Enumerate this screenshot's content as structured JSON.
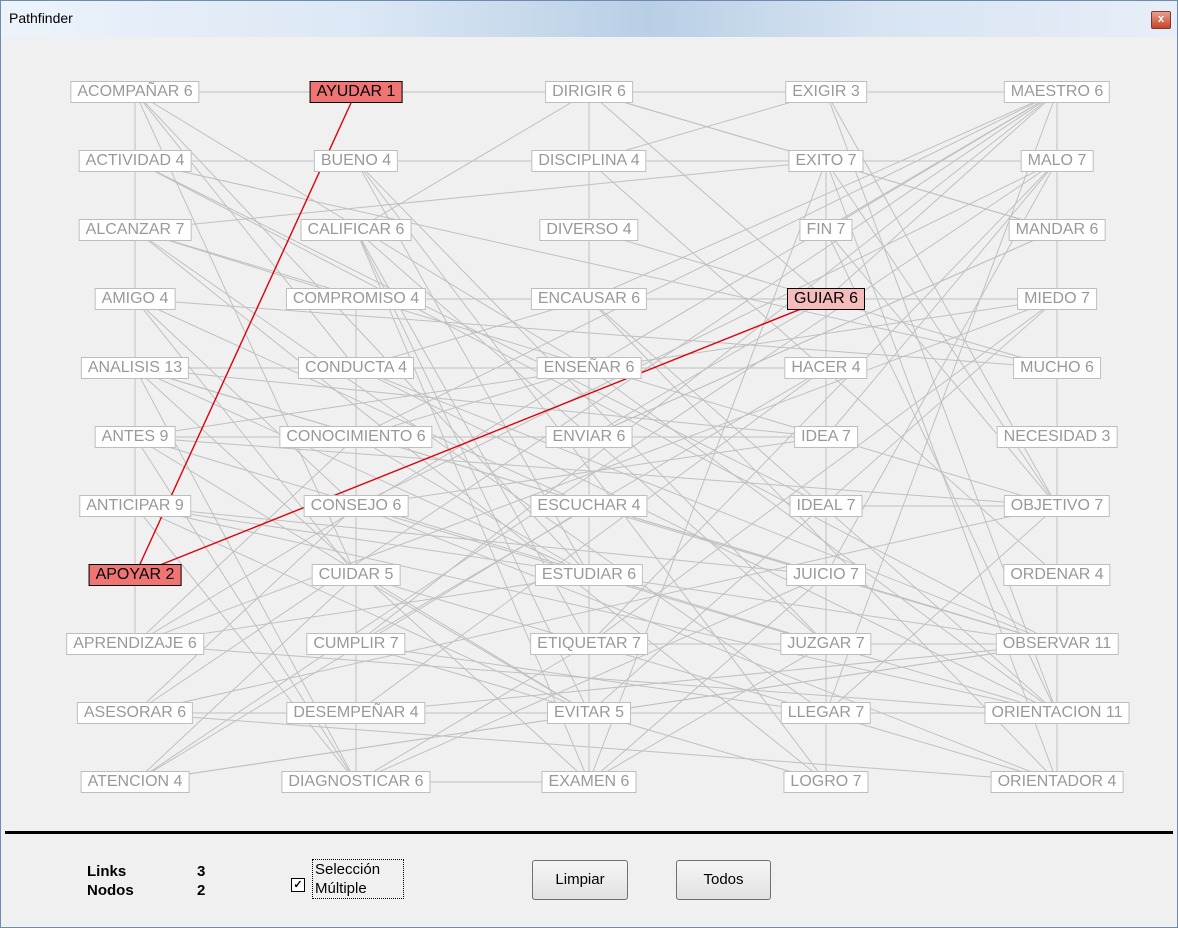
{
  "window": {
    "title": "Pathfinder",
    "close_glyph": "x"
  },
  "columns": [
    {
      "x": 0,
      "nodes": [
        "ACOMPAÑAR 6",
        "ACTIVIDAD 4",
        "ALCANZAR 7",
        "AMIGO 4",
        "ANALISIS 13",
        "ANTES 9",
        "ANTICIPAR 9",
        "APOYAR 2",
        "APRENDIZAJE 6",
        "ASESORAR 6",
        "ATENCION 4"
      ]
    },
    {
      "x": 1,
      "nodes": [
        "AYUDAR 1",
        "BUENO 4",
        "CALIFICAR 6",
        "COMPROMISO 4",
        "CONDUCTA 4",
        "CONOCIMIENTO 6",
        "CONSEJO 6",
        "CUIDAR 5",
        "CUMPLIR 7",
        "DESEMPEÑAR 4",
        "DIAGNOSTICAR 6"
      ]
    },
    {
      "x": 2,
      "nodes": [
        "DIRIGIR 6",
        "DISCIPLINA 4",
        "DIVERSO 4",
        "ENCAUSAR 6",
        "ENSEÑAR 6",
        "ENVIAR 6",
        "ESCUCHAR 4",
        "ESTUDIAR 6",
        "ETIQUETAR 7",
        "EVITAR 5",
        "EXAMEN 6"
      ]
    },
    {
      "x": 3,
      "nodes": [
        "EXIGIR 3",
        "EXITO 7",
        "FIN 7",
        "GUIAR 6",
        "HACER 4",
        "IDEA 7",
        "IDEAL 7",
        "JUICIO 7",
        "JUZGAR 7",
        "LLEGAR 7",
        "LOGRO 7"
      ]
    },
    {
      "x": 4,
      "nodes": [
        "MAESTRO 6",
        "MALO 7",
        "MANDAR 6",
        "MIEDO 7",
        "MUCHO 6",
        "NECESIDAD 3",
        "OBJETIVO 7",
        "ORDENAR 4",
        "OBSERVAR 11",
        "ORIENTACION 11",
        "ORIENTADOR 4"
      ]
    }
  ],
  "selected_nodes": [
    "AYUDAR 1",
    "APOYAR 2"
  ],
  "half_selected_nodes": [
    "GUIAR 6"
  ],
  "highlight_path": [
    [
      "AYUDAR 1",
      "APOYAR 2"
    ],
    [
      "APOYAR 2",
      "GUIAR 6"
    ]
  ],
  "edges": [
    [
      "ACOMPAÑAR 6",
      "AYUDAR 1"
    ],
    [
      "AYUDAR 1",
      "DIRIGIR 6"
    ],
    [
      "DIRIGIR 6",
      "EXIGIR 3"
    ],
    [
      "EXIGIR 3",
      "MAESTRO 6"
    ],
    [
      "ACOMPAÑAR 6",
      "APRENDIZAJE 6"
    ],
    [
      "ACOMPAÑAR 6",
      "CONDUCTA 4"
    ],
    [
      "ACOMPAÑAR 6",
      "ESTUDIAR 6"
    ],
    [
      "ACOMPAÑAR 6",
      "CUIDAR 5"
    ],
    [
      "ACOMPAÑAR 6",
      "ENSEÑAR 6"
    ],
    [
      "MAESTRO 6",
      "ORIENTACION 11"
    ],
    [
      "MAESTRO 6",
      "GUIAR 6"
    ],
    [
      "MAESTRO 6",
      "FIN 7"
    ],
    [
      "MAESTRO 6",
      "ENCAUSAR 6"
    ],
    [
      "MAESTRO 6",
      "CUMPLIR 7"
    ],
    [
      "DIRIGIR 6",
      "ENSEÑAR 6"
    ],
    [
      "DIRIGIR 6",
      "GUIAR 6"
    ],
    [
      "DIRIGIR 6",
      "CALIFICAR 6"
    ],
    [
      "DIRIGIR 6",
      "MANDAR 6"
    ],
    [
      "DIRIGIR 6",
      "ENCAUSAR 6"
    ],
    [
      "EXIGIR 3",
      "OBJETIVO 7"
    ],
    [
      "EXIGIR 3",
      "ORIENTACION 11"
    ],
    [
      "ACTIVIDAD 4",
      "EXITO 7"
    ],
    [
      "ACTIVIDAD 4",
      "IDEAL 7"
    ],
    [
      "ACTIVIDAD 4",
      "OBSERVAR 11"
    ],
    [
      "BUENO 4",
      "MALO 7"
    ],
    [
      "BUENO 4",
      "ESTUDIAR 6"
    ],
    [
      "BUENO 4",
      "JUZGAR 7"
    ],
    [
      "BUENO 4",
      "LOGRO 7"
    ],
    [
      "DISCIPLINA 4",
      "ORDENAR 4"
    ],
    [
      "DISCIPLINA 4",
      "EXAMEN 6"
    ],
    [
      "DISCIPLINA 4",
      "EXIGIR 3"
    ],
    [
      "DISCIPLINA 4",
      "ENVIAR 6"
    ],
    [
      "EXITO 7",
      "FIN 7"
    ],
    [
      "EXITO 7",
      "OBJETIVO 7"
    ],
    [
      "EXITO 7",
      "LOGRO 7"
    ],
    [
      "EXITO 7",
      "ORIENTADOR 4"
    ],
    [
      "EXITO 7",
      "ALCANZAR 7"
    ],
    [
      "MALO 7",
      "ATENCION 4"
    ],
    [
      "MALO 7",
      "IDEA 7"
    ],
    [
      "MALO 7",
      "JUICIO 7"
    ],
    [
      "MALO 7",
      "CONSEJO 6"
    ],
    [
      "MALO 7",
      "ETIQUETAR 7"
    ],
    [
      "ALCANZAR 7",
      "LOGRO 7"
    ],
    [
      "ALCANZAR 7",
      "OBJETIVO 7"
    ],
    [
      "ALCANZAR 7",
      "LLEGAR 7"
    ],
    [
      "ALCANZAR 7",
      "COMPROMISO 4"
    ],
    [
      "CALIFICAR 6",
      "EXAMEN 6"
    ],
    [
      "CALIFICAR 6",
      "JUZGAR 7"
    ],
    [
      "CALIFICAR 6",
      "ETIQUETAR 7"
    ],
    [
      "CALIFICAR 6",
      "EVITAR 5"
    ],
    [
      "DIVERSO 4",
      "MUCHO 6"
    ],
    [
      "DIVERSO 4",
      "ESTUDIAR 6"
    ],
    [
      "FIN 7",
      "OBJETIVO 7"
    ],
    [
      "FIN 7",
      "IDEAL 7"
    ],
    [
      "FIN 7",
      "LLEGAR 7"
    ],
    [
      "FIN 7",
      "ORIENTACION 11"
    ],
    [
      "MANDAR 6",
      "ORDENAR 4"
    ],
    [
      "MANDAR 6",
      "ENVIAR 6"
    ],
    [
      "MANDAR 6",
      "DIRIGIR 6"
    ],
    [
      "AMIGO 4",
      "CONSEJO 6"
    ],
    [
      "AMIGO 4",
      "ESCUCHAR 4"
    ],
    [
      "AMIGO 4",
      "CUIDAR 5"
    ],
    [
      "AMIGO 4",
      "ACOMPAÑAR 6"
    ],
    [
      "COMPROMISO 4",
      "CUMPLIR 7"
    ],
    [
      "COMPROMISO 4",
      "DESEMPEÑAR 4"
    ],
    [
      "COMPROMISO 4",
      "MIEDO 7"
    ],
    [
      "ENCAUSAR 6",
      "ORIENTACION 11"
    ],
    [
      "ENCAUSAR 6",
      "DIRIGIR 6"
    ],
    [
      "ENCAUSAR 6",
      "GUIAR 6"
    ],
    [
      "ENCAUSAR 6",
      "CONDUCTA 4"
    ],
    [
      "ENCAUSAR 6",
      "ORIENTADOR 4"
    ],
    [
      "MIEDO 7",
      "EVITAR 5"
    ],
    [
      "MIEDO 7",
      "NECESIDAD 3"
    ],
    [
      "MIEDO 7",
      "ANTES 9"
    ],
    [
      "ANALISIS 13",
      "OBSERVAR 11"
    ],
    [
      "ANALISIS 13",
      "ESTUDIAR 6"
    ],
    [
      "ANALISIS 13",
      "JUICIO 7"
    ],
    [
      "ANALISIS 13",
      "DIAGNOSTICAR 6"
    ],
    [
      "ANALISIS 13",
      "IDEA 7"
    ],
    [
      "ANALISIS 13",
      "EXAMEN 6"
    ],
    [
      "ANALISIS 13",
      "HACER 4"
    ],
    [
      "CONDUCTA 4",
      "ORIENTACION 11"
    ],
    [
      "CONDUCTA 4",
      "OBSERVAR 11"
    ],
    [
      "ENSEÑAR 6",
      "MAESTRO 6"
    ],
    [
      "ENSEÑAR 6",
      "APRENDIZAJE 6"
    ],
    [
      "ENSEÑAR 6",
      "ORIENTACION 11"
    ],
    [
      "ENSEÑAR 6",
      "CONOCIMIENTO 6"
    ],
    [
      "HACER 4",
      "CUMPLIR 7"
    ],
    [
      "HACER 4",
      "DESEMPEÑAR 4"
    ],
    [
      "MUCHO 6",
      "ACTIVIDAD 4"
    ],
    [
      "MUCHO 6",
      "AMIGO 4"
    ],
    [
      "ANTES 9",
      "ANTICIPAR 9"
    ],
    [
      "ANTES 9",
      "JUZGAR 7"
    ],
    [
      "ANTES 9",
      "EVITAR 5"
    ],
    [
      "ANTES 9",
      "ENVIAR 6"
    ],
    [
      "ANTES 9",
      "DIAGNOSTICAR 6"
    ],
    [
      "ANTES 9",
      "OBJETIVO 7"
    ],
    [
      "CONOCIMIENTO 6",
      "APRENDIZAJE 6"
    ],
    [
      "CONOCIMIENTO 6",
      "ESTUDIAR 6"
    ],
    [
      "CONOCIMIENTO 6",
      "IDEA 7"
    ],
    [
      "CONOCIMIENTO 6",
      "MAESTRO 6"
    ],
    [
      "ENVIAR 6",
      "MANDAR 6"
    ],
    [
      "ENVIAR 6",
      "GUIAR 6"
    ],
    [
      "IDEA 7",
      "IDEAL 7"
    ],
    [
      "IDEA 7",
      "JUICIO 7"
    ],
    [
      "IDEA 7",
      "CONSEJO 6"
    ],
    [
      "NECESIDAD 3",
      "ORIENTADOR 4"
    ],
    [
      "ANTICIPAR 9",
      "OBSERVAR 11"
    ],
    [
      "ANTICIPAR 9",
      "JUICIO 7"
    ],
    [
      "ANTICIPAR 9",
      "ORIENTACION 11"
    ],
    [
      "ANTICIPAR 9",
      "DIAGNOSTICAR 6"
    ],
    [
      "ANTICIPAR 9",
      "EVITAR 5"
    ],
    [
      "CONSEJO 6",
      "ORIENTACION 11"
    ],
    [
      "CONSEJO 6",
      "ASESORAR 6"
    ],
    [
      "CONSEJO 6",
      "ORIENTADOR 4"
    ],
    [
      "ESCUCHAR 4",
      "OBSERVAR 11"
    ],
    [
      "ESCUCHAR 4",
      "ATENCION 4"
    ],
    [
      "IDEAL 7",
      "OBJETIVO 7"
    ],
    [
      "IDEAL 7",
      "LOGRO 7"
    ],
    [
      "OBJETIVO 7",
      "LLEGAR 7"
    ],
    [
      "OBJETIVO 7",
      "ASESORAR 6"
    ],
    [
      "CUIDAR 5",
      "ORIENTADOR 4"
    ],
    [
      "CUIDAR 5",
      "EVITAR 5"
    ],
    [
      "CUIDAR 5",
      "ATENCION 4"
    ],
    [
      "ESTUDIAR 6",
      "APRENDIZAJE 6"
    ],
    [
      "ESTUDIAR 6",
      "EXAMEN 6"
    ],
    [
      "JUICIO 7",
      "JUZGAR 7"
    ],
    [
      "JUICIO 7",
      "DIAGNOSTICAR 6"
    ],
    [
      "JUICIO 7",
      "EXAMEN 6"
    ],
    [
      "ORDENAR 4",
      "MANDAR 6"
    ],
    [
      "APRENDIZAJE 6",
      "ORIENTACION 11"
    ],
    [
      "APRENDIZAJE 6",
      "MIEDO 7"
    ],
    [
      "CUMPLIR 7",
      "LOGRO 7"
    ],
    [
      "CUMPLIR 7",
      "LLEGAR 7"
    ],
    [
      "CUMPLIR 7",
      "DESEMPEÑAR 4"
    ],
    [
      "ETIQUETAR 7",
      "JUZGAR 7"
    ],
    [
      "ETIQUETAR 7",
      "DIAGNOSTICAR 6"
    ],
    [
      "ETIQUETAR 7",
      "MIEDO 7"
    ],
    [
      "JUZGAR 7",
      "EXAMEN 6"
    ],
    [
      "JUZGAR 7",
      "OBSERVAR 11"
    ],
    [
      "OBSERVAR 11",
      "ATENCION 4"
    ],
    [
      "OBSERVAR 11",
      "ORIENTACION 11"
    ],
    [
      "OBSERVAR 11",
      "DESEMPEÑAR 4"
    ],
    [
      "ASESORAR 6",
      "ORIENTADOR 4"
    ],
    [
      "ASESORAR 6",
      "ORIENTACION 11"
    ],
    [
      "ASESORAR 6",
      "MAESTRO 6"
    ],
    [
      "DESEMPEÑAR 4",
      "EVITAR 5"
    ],
    [
      "DESEMPEÑAR 4",
      "LLEGAR 7"
    ],
    [
      "EVITAR 5",
      "ORIENTACION 11"
    ],
    [
      "LLEGAR 7",
      "ORIENTACION 11"
    ],
    [
      "LLEGAR 7",
      "LOGRO 7"
    ],
    [
      "LLEGAR 7",
      "MAESTRO 6"
    ],
    [
      "ORIENTACION 11",
      "ORIENTADOR 4"
    ],
    [
      "ATENCION 4",
      "OBSERVAR 11"
    ],
    [
      "DIAGNOSTICAR 6",
      "EXAMEN 6"
    ],
    [
      "DIAGNOSTICAR 6",
      "CONOCIMIENTO 6"
    ],
    [
      "EXAMEN 6",
      "EXITO 7"
    ],
    [
      "LOGRO 7",
      "EXITO 7"
    ]
  ],
  "stats": {
    "links_label": "Links",
    "links_value": "3",
    "nodes_label": "Nodos",
    "nodes_value": "2"
  },
  "multi_select": {
    "checked": true,
    "check_glyph": "✓",
    "label_line1": "Selección",
    "label_line2": "Múltiple"
  },
  "buttons": {
    "clear_label": "Limpiar",
    "all_label": "Todos"
  },
  "colors": {
    "edge": "#c0c0c0",
    "path": "#e0000f",
    "selected": "#f07474",
    "half_selected": "#f6bcbc"
  }
}
